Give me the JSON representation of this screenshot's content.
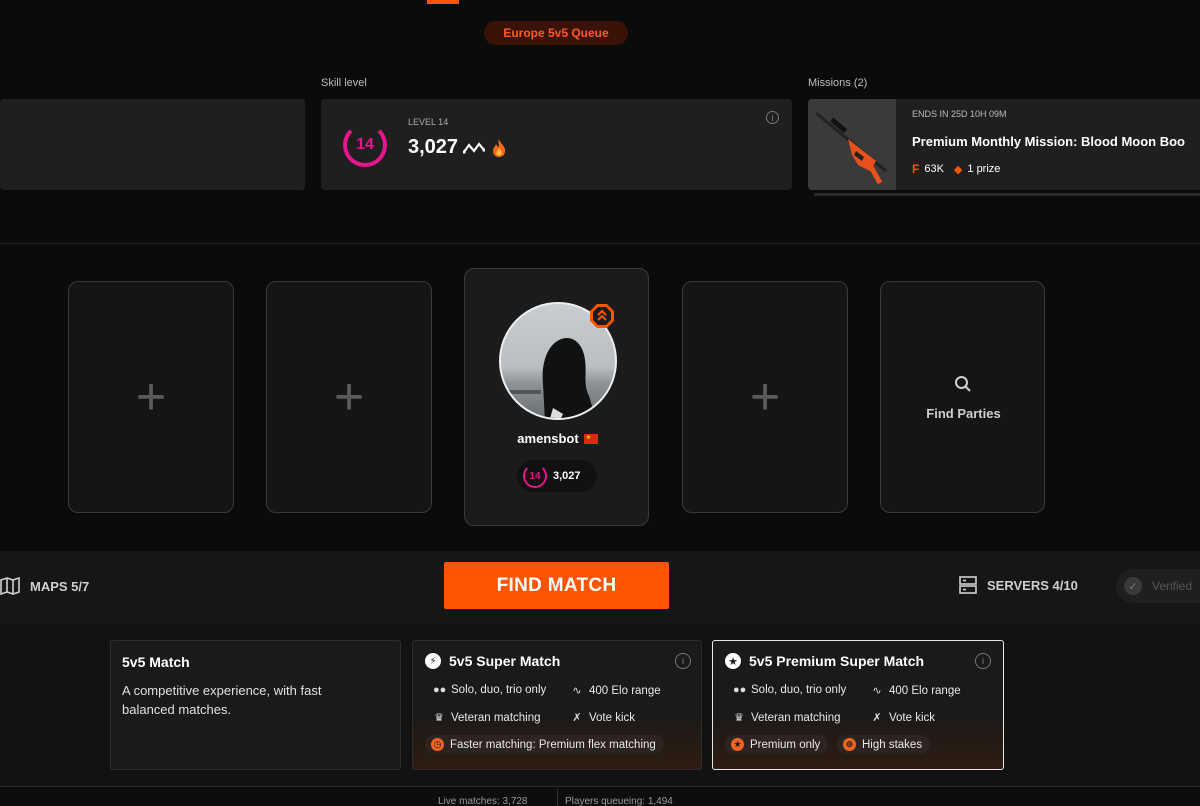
{
  "queue": {
    "label": "Europe 5v5 Queue"
  },
  "skill": {
    "section_label": "Skill level",
    "level_label": "LEVEL 14",
    "level": "14",
    "elo": "3,027",
    "trend_icon": "elo-wave-icon",
    "fire_icon": "fire-icon",
    "info_icon": "info-icon"
  },
  "missions": {
    "section_label": "Missions (2)",
    "ends": "ENDS IN 25D 10H 09M",
    "title": "Premium Monthly Mission: Blood Moon Boo",
    "points": "63K",
    "prize": "1 prize",
    "weapon_image": "sniper-rifle-skin-image"
  },
  "party": {
    "player_name": "amensbot",
    "player_level": "14",
    "player_elo": "3,027",
    "flag_icon": "flag-icon",
    "find_parties_label": "Find Parties",
    "slot_plus": "+"
  },
  "controls": {
    "maps_label": "MAPS 5/7",
    "find_match_label": "FIND MATCH",
    "servers_label": "SERVERS 4/10",
    "verified_label": "Verified"
  },
  "modes": [
    {
      "title": "5v5 Match",
      "description": "A competitive experience, with fast balanced matches."
    },
    {
      "title": "5v5 Super Match",
      "features": [
        "Solo, duo, trio only",
        "400 Elo range",
        "Veteran matching",
        "Vote kick"
      ],
      "highlight": "Faster matching: Premium flex matching"
    },
    {
      "title": "5v5 Premium Super Match",
      "features": [
        "Solo, duo, trio only",
        "400 Elo range",
        "Veteran matching",
        "Vote kick"
      ],
      "highlights": [
        "Premium only",
        "High stakes"
      ]
    }
  ],
  "footer": {
    "live_matches": "Live matches: 3,728",
    "players_queueing": "Players queueing: 1,494"
  },
  "colors": {
    "accent": "#ff5500",
    "level": "#e8158c",
    "background": "#0b0b0b"
  }
}
